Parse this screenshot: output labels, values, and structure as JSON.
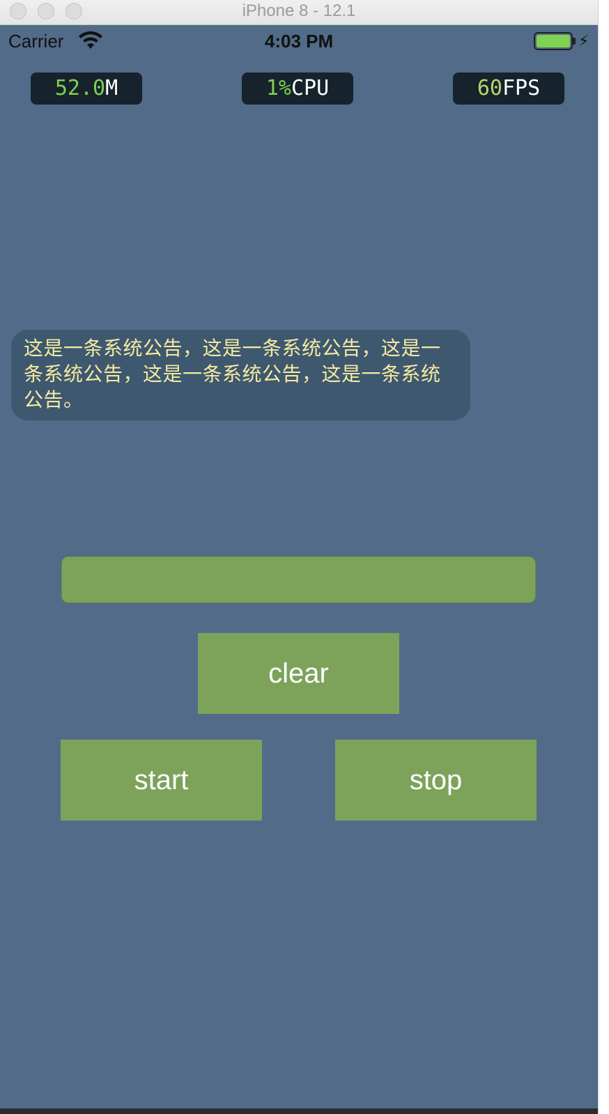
{
  "window": {
    "title": "iPhone 8 - 12.1"
  },
  "status_bar": {
    "carrier": "Carrier",
    "time": "4:03 PM",
    "battery_color": "#7fd151"
  },
  "perf_monitor": {
    "memory": {
      "value": "52.0",
      "unit": "M"
    },
    "cpu": {
      "value": "1%",
      "unit": "CPU"
    },
    "fps": {
      "value": "60",
      "unit": "FPS"
    }
  },
  "notice": {
    "text": "这是一条系统公告，这是一条系统公告，这是一条系统公告，这是一条系统公告，这是一条系统公告。"
  },
  "input": {
    "value": "",
    "placeholder": ""
  },
  "buttons": {
    "clear": "clear",
    "start": "start",
    "stop": "stop"
  },
  "colors": {
    "screen_bg": "#516b89",
    "button_bg": "#7da35b",
    "notice_bg": "#3e5870",
    "notice_text": "#f7eba0"
  }
}
